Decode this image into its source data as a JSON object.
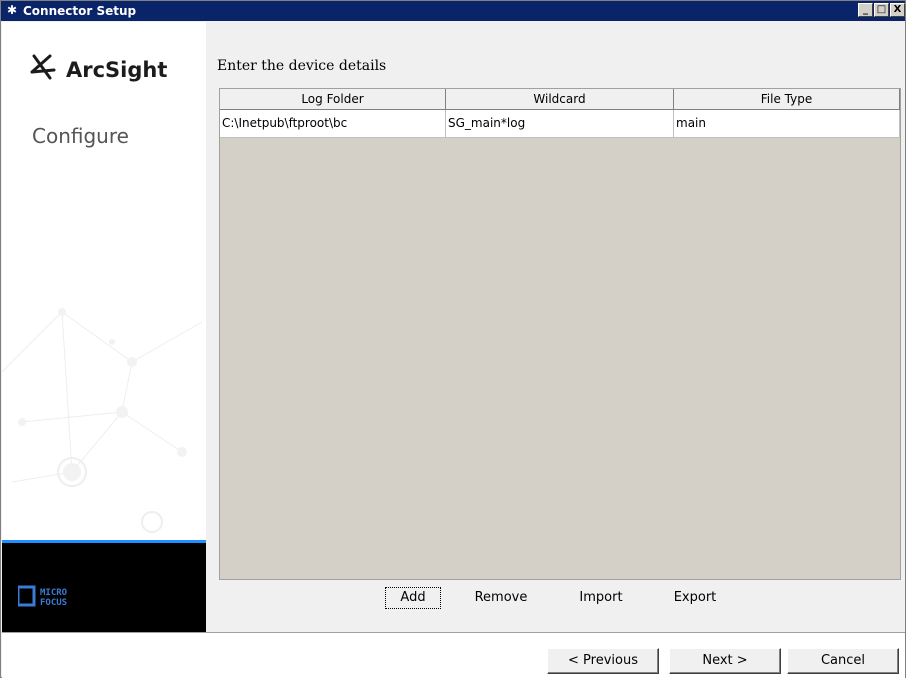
{
  "window": {
    "title": "Connector Setup",
    "controls": {
      "minimize": "_",
      "maximize": "□",
      "close": "X"
    },
    "title_icon": "arcsight-icon"
  },
  "sidebar": {
    "brand": "ArcSight",
    "step": "Configure",
    "footer_logo": "MICRO FOCUS",
    "accent_color": "#1e90ff"
  },
  "main": {
    "heading": "Enter the device details",
    "table": {
      "columns": [
        "Log Folder",
        "Wildcard",
        "File Type"
      ],
      "rows": [
        [
          "C:\\Inetpub\\ftproot\\bc",
          "SG_main*log",
          "main"
        ]
      ]
    },
    "actions": {
      "add": "Add",
      "remove": "Remove",
      "import": "Import",
      "export": "Export"
    }
  },
  "footer": {
    "previous": "< Previous",
    "next": "Next >",
    "cancel": "Cancel"
  }
}
